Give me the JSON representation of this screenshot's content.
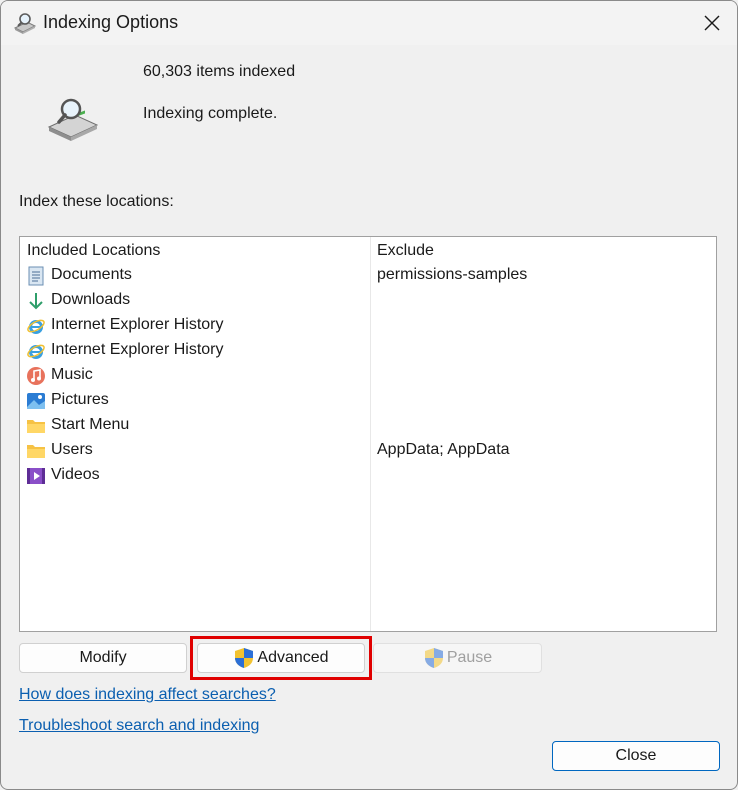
{
  "window": {
    "title": "Indexing Options"
  },
  "status": {
    "items_indexed": "60,303 items indexed",
    "state": "Indexing complete."
  },
  "locations": {
    "label": "Index these locations:",
    "col_included": "Included Locations",
    "col_exclude": "Exclude",
    "rows": [
      {
        "name": "Documents",
        "exclude": "permissions-samples",
        "icon": "documents-icon"
      },
      {
        "name": "Downloads",
        "exclude": "",
        "icon": "downloads-icon"
      },
      {
        "name": "Internet Explorer History",
        "exclude": "",
        "icon": "internet-explorer-icon"
      },
      {
        "name": "Internet Explorer History",
        "exclude": "",
        "icon": "internet-explorer-icon"
      },
      {
        "name": "Music",
        "exclude": "",
        "icon": "music-icon"
      },
      {
        "name": "Pictures",
        "exclude": "",
        "icon": "pictures-icon"
      },
      {
        "name": "Start Menu",
        "exclude": "",
        "icon": "folder-icon"
      },
      {
        "name": "Users",
        "exclude": "AppData; AppData",
        "icon": "folder-icon"
      },
      {
        "name": "Videos",
        "exclude": "",
        "icon": "videos-icon"
      }
    ]
  },
  "buttons": {
    "modify": "Modify",
    "advanced": "Advanced",
    "pause": "Pause",
    "close": "Close"
  },
  "links": {
    "how_indexing": "How does indexing affect searches?",
    "troubleshoot": "Troubleshoot search and indexing"
  },
  "colors": {
    "link": "#0b5fb0",
    "highlight": "#e00000",
    "default_button_border": "#0067c0"
  }
}
